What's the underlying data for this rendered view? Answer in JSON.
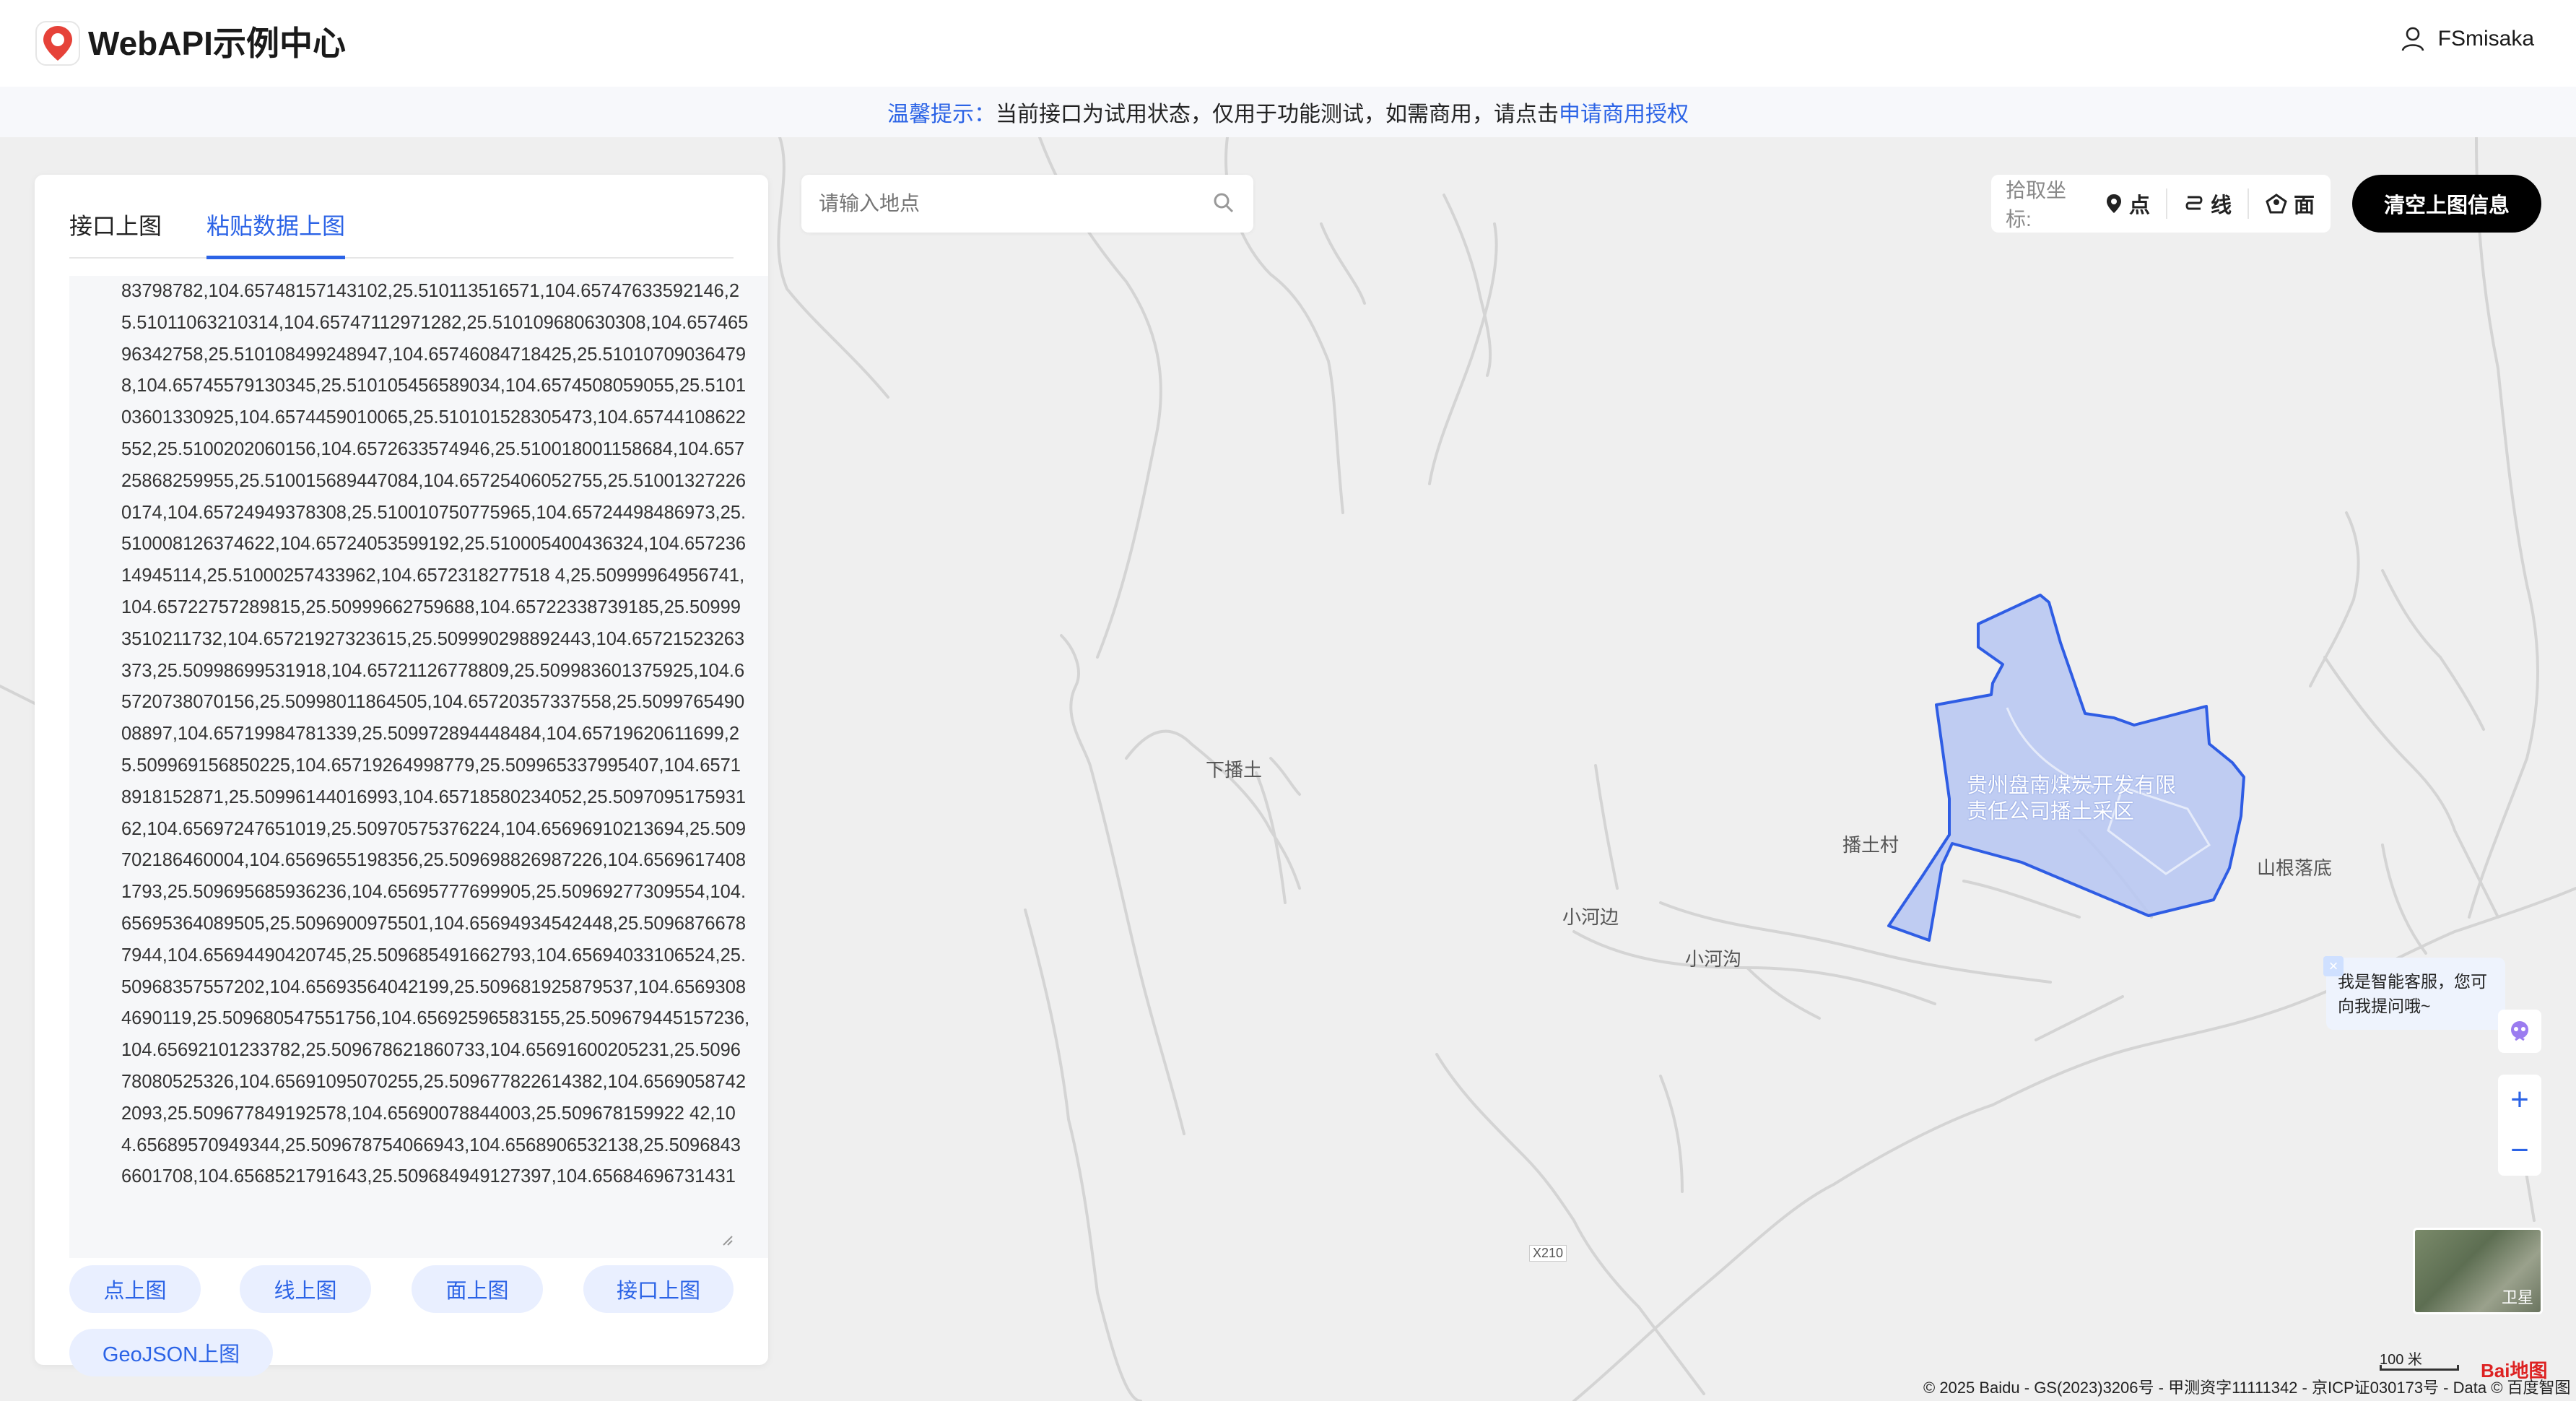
{
  "app": {
    "title": "WebAPI示例中心",
    "user": "FSmisaka"
  },
  "notice": {
    "prefix": "温馨提示：",
    "text": "当前接口为试用状态，仅用于功能测试，如需商用，请点击",
    "link": "申请商用授权"
  },
  "panel": {
    "tabs": [
      {
        "label": "接口上图",
        "active": false
      },
      {
        "label": "粘贴数据上图",
        "active": true
      }
    ],
    "textarea": "83798782,104.65748157143102,25.510113516571,104.65747633592146,25.51011063210314,104.65747112971282,25.510109680630308,104.65746596342758,25.510108499248947,104.65746084718425,25.510107090364798,104.65745579130345,25.510105456589034,104.6574508059055,25.510103601330925,104.6574459010065,25.510101528305473,104.65744108622552,25.5100202060156,104.6572633574946,25.510018001158684,104.65725868259955,25.510015689447084,104.65725406052755,25.510013272260174,104.65724949378308,25.510010750775965,104.65724498486973,25.510008126374622,104.65724053599192,25.510005400436324,104.65723614945114,25.51000257433962,104.6572318277518 4,25.50999964956741,104.65722757289815,25.50999662759688,104.65722338739185,25.509993510211732,104.65721927323615,25.509990298892443,104.65721523263373,25.50998699531918,104.65721126778809,25.509983601375925,104.65720738070156,25.50998011864505,104.65720357337558,25.509976549008897,104.65719984781339,25.509972894448484,104.65719620611699,25.509969156850225,104.65719264998779,25.509965337995407,104.65718918152871,25.50996144016993,104.65718580234052,25.509709517593162,104.65697247651019,25.50970575376224,104.65696910213694,25.509702186460004,104.6569655198356,25.509698826987226,104.65696174081793,25.509695685936236,104.65695777699905,25.50969277309554,104.65695364089505,25.5096900975501,104.65694934542448,25.50968766787944,104.65694490420745,25.509685491662793,104.65694033106524,25.50968357557202,104.65693564042199,25.509681925879537,104.65693084690119,25.509680547551756,104.65692596583155,25.509679445157236,104.65692101233782,25.509678621860733,104.65691600205231,25.509678080525326,104.65691095070255,25.509677822614382,104.65690587422093,25.509677849192578,104.65690078844003,25.509678159922 42,104.65689570949344,25.509678754066943,104.6568906532138,25.50968436601708,104.6568521791643,25.509684949127397,104.65684696731431",
    "buttons": [
      "点上图",
      "线上图",
      "面上图",
      "接口上图",
      "GeoJSON上图"
    ]
  },
  "search": {
    "placeholder": "请输入地点"
  },
  "picker": {
    "label": "拾取坐标:",
    "items": [
      "点",
      "线",
      "面"
    ]
  },
  "clear_button": "清空上图信息",
  "map_labels": {
    "xiabotu": "下播土",
    "botucun": "播土村",
    "xiaohebian": "小河边",
    "xiaohegou": "小河沟",
    "shangenluodi": "山根落底",
    "polygon_name": "贵州盘南煤炭开发有限责任公司播土采区",
    "road": "X210"
  },
  "assistant": "我是智能客服，您可向我提问哦~",
  "satellite_label": "卫星",
  "scale_label": "100 米",
  "copyright": "© 2025 Baidu - GS(2023)3206号 - 甲测资字11111342 - 京ICP证030173号 - Data © 百度智图",
  "colors": {
    "accent": "#2b63e6",
    "polygon_fill": "#b9c8f2",
    "polygon_stroke": "#2f5de4"
  }
}
